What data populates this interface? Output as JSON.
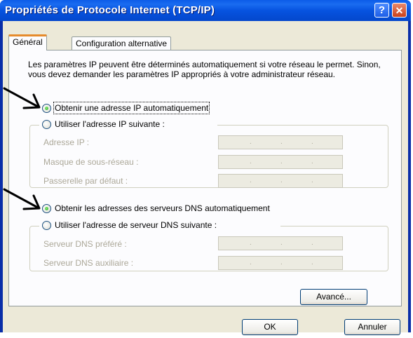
{
  "window": {
    "title": "Propriétés de Protocole Internet (TCP/IP)",
    "help_label": "?",
    "close_label": "✕"
  },
  "tabs": [
    {
      "label": "Général"
    },
    {
      "label": "Configuration alternative"
    }
  ],
  "description": "Les paramètres IP peuvent être déterminés automatiquement si votre réseau le permet. Sinon, vous devez demander les paramètres IP appropriés à votre administrateur réseau.",
  "ip": {
    "auto_label": "Obtenir une adresse IP automatiquement",
    "manual_label": "Utiliser l'adresse IP suivante :",
    "selected": "auto",
    "fields": [
      {
        "label": "Adresse IP :"
      },
      {
        "label": "Masque de sous-réseau :"
      },
      {
        "label": "Passerelle par défaut :"
      }
    ]
  },
  "dns": {
    "auto_label": "Obtenir les adresses des serveurs DNS automatiquement",
    "manual_label": "Utiliser l'adresse de serveur DNS suivante :",
    "selected": "auto",
    "fields": [
      {
        "label": "Serveur DNS préféré :"
      },
      {
        "label": "Serveur DNS auxiliaire :"
      }
    ]
  },
  "buttons": {
    "advanced": "Avancé...",
    "ok": "OK",
    "cancel": "Annuler"
  },
  "ip_separator": "."
}
